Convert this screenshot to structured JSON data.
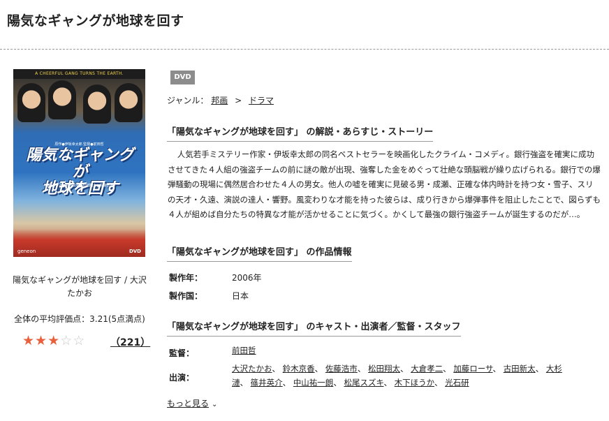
{
  "page": {
    "title": "陽気なギャングが地球を回す"
  },
  "cover": {
    "tagline": "A CHEERFUL GANG TURNS THE EARTH.",
    "credits": "原作●伊坂幸太郎 監督●前田哲",
    "title_line1": "陽気なギャングが",
    "title_line2": "地球を回す",
    "cast": "大沢たかお●鈴木京香●松田翔太●佐藤浩市",
    "logo": "geneon",
    "dvd_mark": "DVD"
  },
  "left": {
    "caption": "陽気なギャングが地球を回す / 大沢たかお",
    "avg_rating_label": "全体の平均評価点：3.21(5点満点)",
    "rating_value": 3.21,
    "stars_full": 3,
    "stars_empty": 2,
    "review_count": "（221）"
  },
  "product": {
    "format_badge": "DVD",
    "genre_label": "ジャンル：",
    "genre_items": [
      "邦画",
      "ドラマ"
    ],
    "genre_separator": ">"
  },
  "sections": {
    "synopsis_title": "「陽気なギャングが地球を回す」 の解説・あらすじ・ストーリー",
    "synopsis_text": "人気若手ミステリー作家・伊坂幸太郎の同名ベストセラーを映画化したクライム・コメディ。銀行強盗を確実に成功させてきた４人組の強盗チームの前に謎の敵が出現、強奪した金をめぐって壮絶な頭脳戦が繰り広げられる。銀行での爆弾騒動の現場に偶然居合わせた４人の男女。他人の嘘を確実に見破る男・成瀬、正確な体内時計を持つ女・雪子、スリの天才・久遠、演説の達人・響野。風変わりな才能を持った彼らは、成り行きから爆弾事件を阻止したことで、図らずも４人が組めば自分たちの特異な才能が活かせることに気づく。かくして最強の銀行強盗チームが誕生するのだが…。",
    "info_title": "「陽気なギャングが地球を回す」 の作品情報",
    "info": {
      "year_label": "製作年：",
      "year_value": "2006年",
      "country_label": "製作国：",
      "country_value": "日本"
    },
    "cast_title": "「陽気なギャングが地球を回す」 のキャスト・出演者／監督・スタッフ",
    "director_label": "監督：",
    "director": "前田哲",
    "cast_label": "出演：",
    "cast_line1": [
      "大沢たかお",
      "鈴木京香",
      "佐藤浩市",
      "松田翔太",
      "大倉孝二",
      "加藤ローサ",
      "古田新太",
      "大杉"
    ],
    "cast_line2": [
      "漣",
      "篠井英介",
      "中山祐一朗",
      "松尾スズキ",
      "木下ほうか",
      "光石研"
    ],
    "more_label": "もっと見る"
  },
  "colors": {
    "star_full": "#e8603c",
    "star_empty": "#c8c8c8",
    "badge_bg": "#8c8c8c"
  }
}
